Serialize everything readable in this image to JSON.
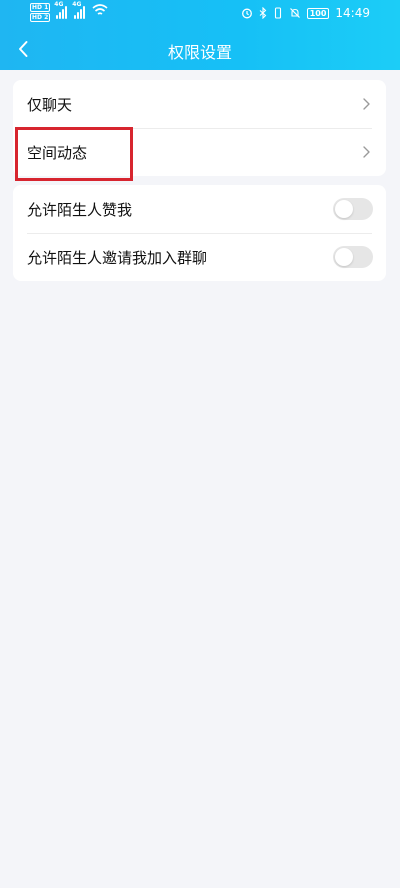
{
  "status_bar": {
    "hd_top": "HD 1",
    "hd_bottom": "HD 2",
    "network_tag_1": "4G",
    "network_tag_2": "4G",
    "time": "14:49",
    "battery": "100",
    "icons": [
      "alarm-icon",
      "bluetooth-icon",
      "vibrate-icon",
      "mute-bell-icon",
      "wifi-icon"
    ]
  },
  "header": {
    "title": "权限设置",
    "back_icon": "chevron-left-icon",
    "gradient_colors": [
      "#1fb6f2",
      "#1ccdf7"
    ]
  },
  "sections": {
    "group1": [
      {
        "label": "仅聊天",
        "type": "link"
      },
      {
        "label": "空间动态",
        "type": "link"
      }
    ],
    "group2": [
      {
        "label": "允许陌生人赞我",
        "type": "toggle",
        "on": false
      },
      {
        "label": "允许陌生人邀请我加入群聊",
        "type": "toggle",
        "on": false
      }
    ]
  },
  "colors": {
    "background": "#f4f5f9",
    "card": "#ffffff",
    "highlight": "#d7252f",
    "toggle_off": "#e6e6e6"
  }
}
